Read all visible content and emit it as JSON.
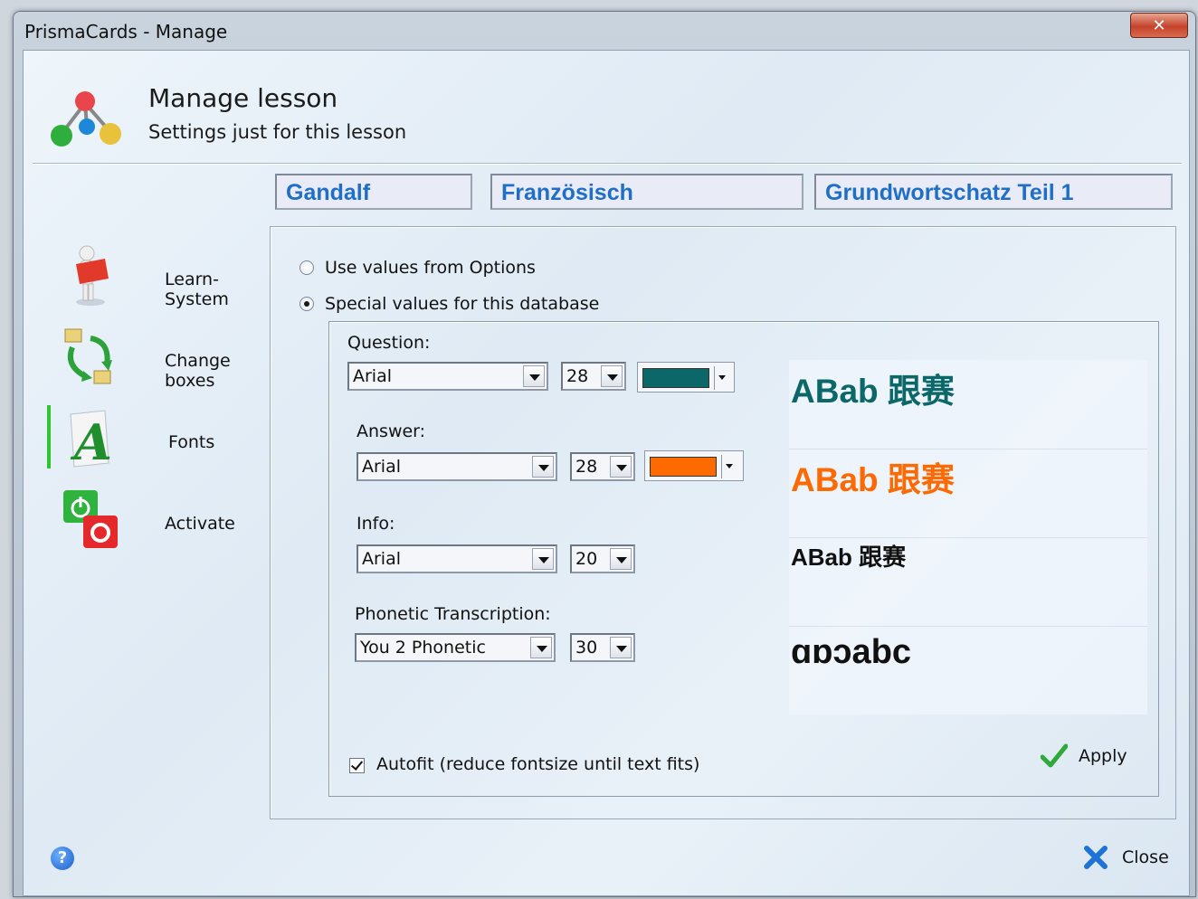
{
  "window": {
    "title": "PrismaCards - Manage",
    "close_glyph": "✕"
  },
  "header": {
    "title": "Manage lesson",
    "subtitle": "Settings just for this lesson"
  },
  "breadcrumb": [
    "Gandalf",
    "Französisch",
    "Grundwortschatz Teil 1"
  ],
  "nav": {
    "items": [
      {
        "label": "Learn-System",
        "icon": "learn-system-icon"
      },
      {
        "label": "Change boxes",
        "icon": "change-boxes-icon"
      },
      {
        "label": "Fonts",
        "icon": "fonts-icon",
        "active": true
      },
      {
        "label": "Activate",
        "icon": "activate-icon"
      }
    ]
  },
  "options": {
    "use_options": "Use values from Options",
    "special_values": "Special values for this database",
    "selected": "special_values"
  },
  "fonts": {
    "question": {
      "label": "Question:",
      "font": "Arial",
      "size": "28",
      "color": "#0b6768"
    },
    "answer": {
      "label": "Answer:",
      "font": "Arial",
      "size": "28",
      "color": "#ff6a00"
    },
    "info": {
      "label": "Info:",
      "font": "Arial",
      "size": "20"
    },
    "phonetic": {
      "label": "Phonetic Transcription:",
      "font": "You 2 Phonetic",
      "size": "30"
    }
  },
  "preview": {
    "question": "ABab 跟赛",
    "answer": "ABab 跟赛",
    "info": "ABab 跟赛",
    "phonetic": "ɑɒɔabc"
  },
  "autofit": {
    "label": "Autofit (reduce fontsize until text fits)",
    "checked": true
  },
  "buttons": {
    "apply": "Apply",
    "close": "Close",
    "help": "?"
  }
}
